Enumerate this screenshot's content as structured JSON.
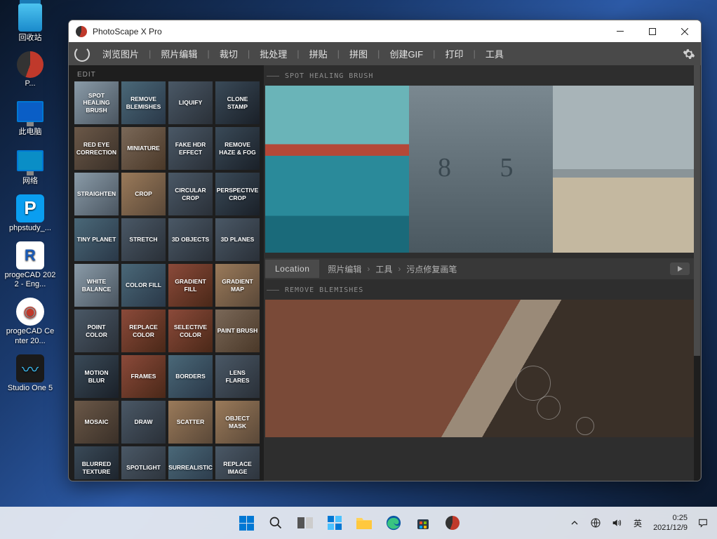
{
  "desktop": [
    {
      "label": "回收站"
    },
    {
      "label": "P..."
    },
    {
      "label": "此电脑"
    },
    {
      "label": "网络"
    },
    {
      "label": "phpstudy_..."
    },
    {
      "label": "progeCAD 2022 - Eng..."
    },
    {
      "label": "progeCAD Center 20..."
    },
    {
      "label": "Studio One 5"
    }
  ],
  "window": {
    "title": "PhotoScape X Pro",
    "tabs": [
      "浏览图片",
      "照片编辑",
      "裁切",
      "批处理",
      "拼贴",
      "拼图",
      "创建GIF",
      "打印",
      "工具"
    ],
    "edit_label": "EDIT"
  },
  "tiles": [
    "SPOT HEALING BRUSH",
    "REMOVE BLEMISHES",
    "LIQUIFY",
    "CLONE STAMP",
    "RED EYE CORRECTION",
    "MINIATURE",
    "FAKE HDR EFFECT",
    "REMOVE HAZE & FOG",
    "STRAIGHTEN",
    "CROP",
    "CIRCULAR CROP",
    "PERSPECTIVE CROP",
    "TINY PLANET",
    "STRETCH",
    "3D OBJECTS",
    "3D PLANES",
    "WHITE BALANCE",
    "COLOR FILL",
    "GRADIENT FILL",
    "GRADIENT MAP",
    "POINT COLOR",
    "REPLACE COLOR",
    "SELECTIVE COLOR",
    "PAINT BRUSH",
    "MOTION BLUR",
    "FRAMES",
    "BORDERS",
    "LENS FLARES",
    "MOSAIC",
    "DRAW",
    "SCATTER",
    "OBJECT MASK",
    "BLURRED TEXTURE",
    "SPOTLIGHT",
    "SURREALISTIC",
    "REPLACE IMAGE"
  ],
  "sections": {
    "s1": "SPOT HEALING BRUSH",
    "s2": "REMOVE BLEMISHES"
  },
  "location": {
    "tag": "Location",
    "crumbs": [
      "照片编辑",
      "工具",
      "污点修复画笔"
    ]
  },
  "tray": {
    "ime": "英",
    "time": "0:25",
    "date": "2021/12/9"
  }
}
